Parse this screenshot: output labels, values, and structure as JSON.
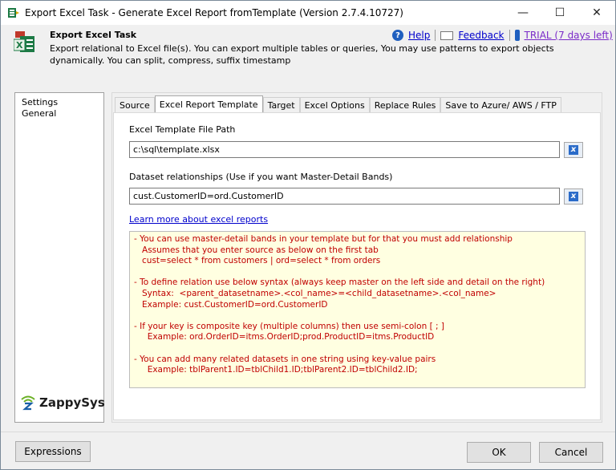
{
  "window": {
    "title": "Export Excel Task - Generate Excel Report fromTemplate (Version 2.7.4.10727)",
    "controls": {
      "minimize": "—",
      "maximize": "☐",
      "close": "✕"
    }
  },
  "header": {
    "title": "Export Excel Task",
    "description": "Export relational to Excel file(s). You can export multiple tables or queries, You may use patterns to export objects dynamically. You can split, compress, suffix timestamp",
    "links": {
      "help": "Help",
      "feedback": "Feedback",
      "trial": "TRIAL (7 days left)"
    }
  },
  "sidebar": {
    "items": [
      {
        "label": "Settings"
      },
      {
        "label": "General"
      }
    ],
    "logo_text": "ZappySys"
  },
  "tabs": [
    {
      "label": "Source",
      "active": false
    },
    {
      "label": "Excel Report Template",
      "active": true
    },
    {
      "label": "Target",
      "active": false
    },
    {
      "label": "Excel Options",
      "active": false
    },
    {
      "label": "Replace Rules",
      "active": false
    },
    {
      "label": "Save to Azure/ AWS / FTP",
      "active": false
    }
  ],
  "form": {
    "template_path_label": "Excel Template File Path",
    "template_path_value": "c:\\sql\\template.xlsx",
    "relationships_label": "Dataset relationships (Use if you want Master-Detail Bands)",
    "relationships_value": "cust.CustomerID=ord.CustomerID",
    "learn_more": "Learn more about excel reports"
  },
  "notes": [
    "- You can use master-detail bands in your template but for that you must add relationship",
    "   Assumes that you enter source as below on the first tab",
    "   cust=select * from customers | ord=select * from orders",
    "",
    "- To define relation use below syntax (always keep master on the left side and detail on the right)",
    "   Syntax:  <parent_datasetname>.<col_name>=<child_datasetname>.<col_name>",
    "   Example: cust.CustomerID=ord.CustomerID",
    "",
    "- If your key is composite key (multiple columns) then use semi-colon [ ; ]",
    "     Example: ord.OrderID=itms.OrderID;prod.ProductID=itms.ProductID",
    "",
    "- You can add many related datasets in one string using key-value pairs",
    "     Example: tblParent1.ID=tblChild1.ID;tblParent2.ID=tblChild2.ID;"
  ],
  "buttons": {
    "expressions": "Expressions",
    "ok": "OK",
    "cancel": "Cancel"
  },
  "icons": {
    "app": "export-excel-app-icon",
    "task": "excel-task-icon",
    "help": "help-icon",
    "feedback": "mail-icon",
    "trial": "info-icon",
    "clear": "clear-field-icon",
    "logo": "zappysys-logo-icon"
  },
  "colors": {
    "link": "#0000cc",
    "trial": "#7a2ac8",
    "notes_text": "#c00000",
    "notes_bg": "#ffffe1",
    "excel_green": "#1d7a45"
  }
}
